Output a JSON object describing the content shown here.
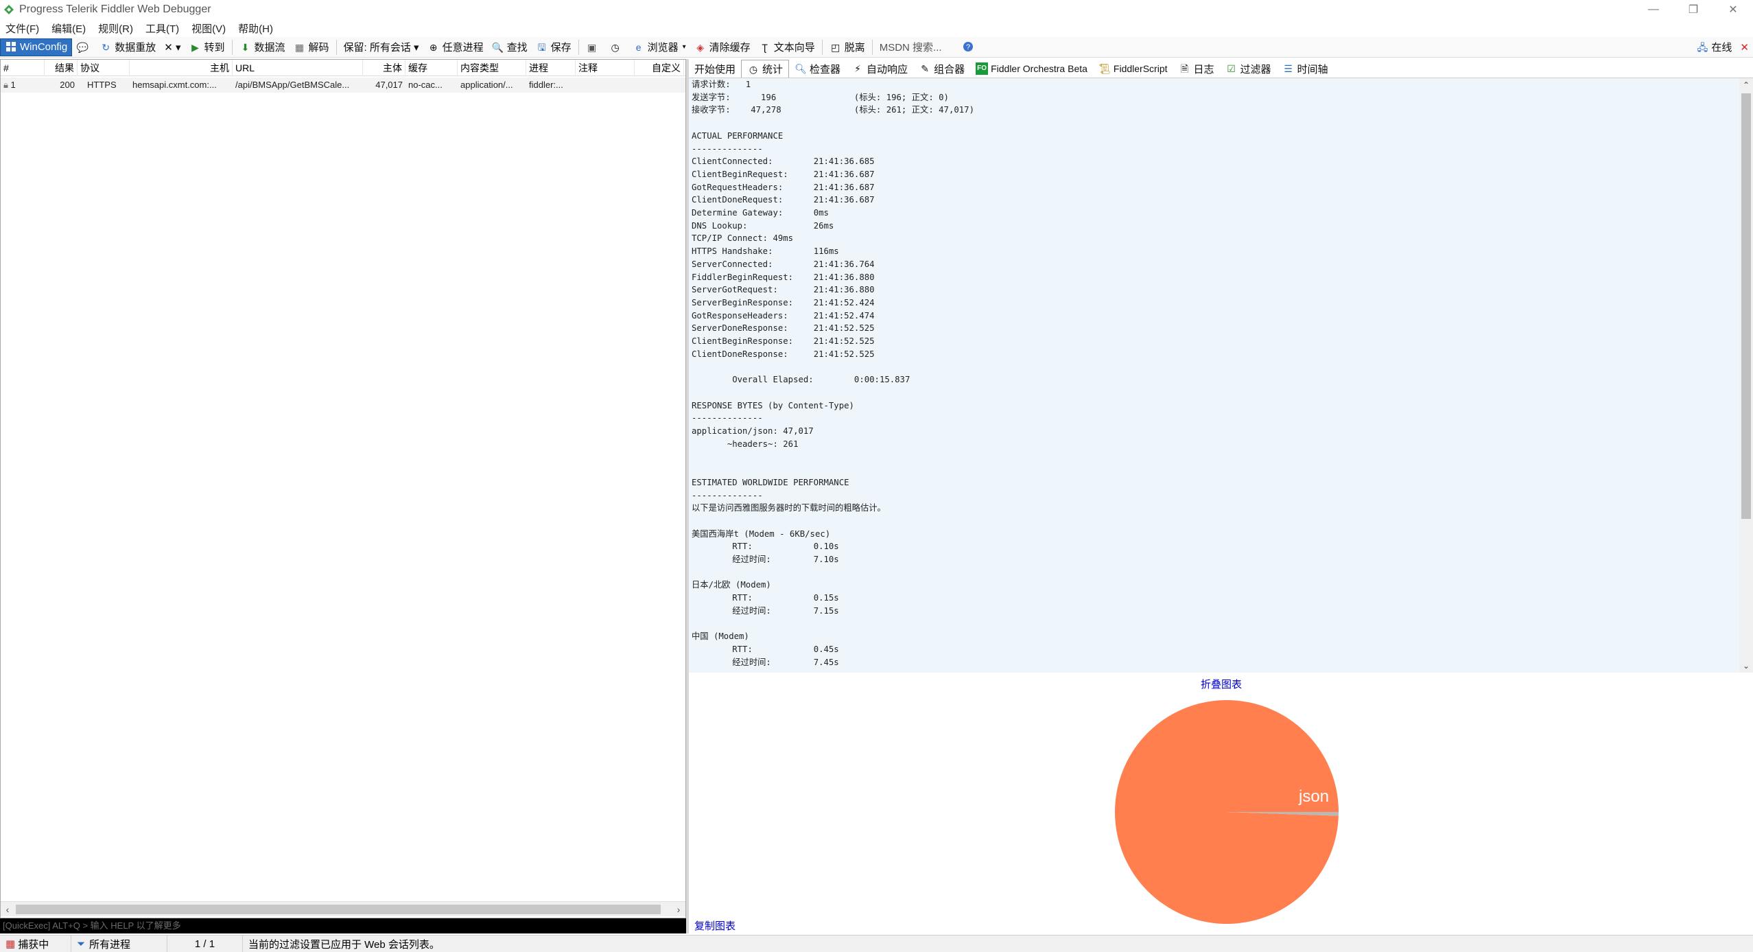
{
  "window": {
    "title": "Progress Telerik Fiddler Web Debugger",
    "controls": [
      "—",
      "❐",
      "✕"
    ]
  },
  "menu": [
    "文件(F)",
    "编辑(E)",
    "规则(R)",
    "工具(T)",
    "视图(V)",
    "帮助(H)"
  ],
  "toolbar": {
    "winconfig": "WinConfig",
    "replay": "数据重放",
    "remove": "✕ ▾",
    "go": "转到",
    "stream": "数据流",
    "decode": "解码",
    "keep": "保留: 所有会话 ▾",
    "any_process": "任意进程",
    "find": "查找",
    "save": "保存",
    "browse": "浏览器",
    "clear_cache": "清除缓存",
    "text_wizard": "文本向导",
    "tearoff": "脱离",
    "msdn_placeholder": "MSDN 搜索...",
    "online": "在线",
    "close": "✕"
  },
  "sessions": {
    "columns": [
      "#",
      "结果",
      "协议",
      "主机",
      "URL",
      "主体",
      "缓存",
      "内容类型",
      "进程",
      "注释",
      "自定义"
    ],
    "rows": [
      {
        "num": "1",
        "result": "200",
        "protocol": "HTTPS",
        "host": "hemsapi.cxmt.com:...",
        "url": "/api/BMSApp/GetBMSCale...",
        "body": "47,017",
        "caching": "no-cac...",
        "content_type": "application/...",
        "process": "fiddler:...",
        "comments": "",
        "custom": ""
      }
    ]
  },
  "quickexec": "[QuickExec] ALT+Q > 输入 HELP 以了解更多",
  "tabs": [
    "开始使用",
    "统计",
    "检查器",
    "自动响应",
    "组合器",
    "Fiddler Orchestra Beta",
    "FiddlerScript",
    "日志",
    "过滤器",
    "时间轴"
  ],
  "stats_text": "请求计数:   1\n发送字节:      196\t\t(标头: 196; 正文: 0)\n接收字节:    47,278\t\t(标头: 261; 正文: 47,017)\n\nACTUAL PERFORMANCE\n--------------\nClientConnected:\t21:41:36.685\nClientBeginRequest:\t21:41:36.687\nGotRequestHeaders:\t21:41:36.687\nClientDoneRequest:\t21:41:36.687\nDetermine Gateway:\t0ms\nDNS Lookup: \t\t26ms\nTCP/IP Connect:\t49ms\nHTTPS Handshake:\t116ms\nServerConnected:\t21:41:36.764\nFiddlerBeginRequest:\t21:41:36.880\nServerGotRequest:\t21:41:36.880\nServerBeginResponse:\t21:41:52.424\nGotResponseHeaders:\t21:41:52.474\nServerDoneResponse:\t21:41:52.525\nClientBeginResponse:\t21:41:52.525\nClientDoneResponse:\t21:41:52.525\n\n\tOverall Elapsed:\t0:00:15.837\n\nRESPONSE BYTES (by Content-Type)\n--------------\napplication/json: 47,017\n       ~headers~: 261\n\n\nESTIMATED WORLDWIDE PERFORMANCE\n--------------\n以下是访问西雅图服务器时的下载时间的粗略估计。\n\n美国西海岸t (Modem - 6KB/sec)\n\tRTT:\t\t0.10s\n\t经过时间:\t7.10s\n\n日本/北欧 (Modem)\n\tRTT:\t\t0.15s\n\t经过时间:\t7.15s\n\n中国 (Modem)\n\tRTT:\t\t0.45s\n\t经过时间:\t7.45s",
  "chart": {
    "collapse_label": "折叠图表",
    "copy_label": "复制图表",
    "pie_color": "#ff7f4f",
    "slices": [
      {
        "label": "json",
        "value": 47017
      },
      {
        "label": "~headers~",
        "value": 261
      }
    ]
  },
  "status": {
    "capturing": "捕获中",
    "process_filter": "所有进程",
    "count": "1 / 1",
    "message": "当前的过滤设置已应用于 Web 会话列表。"
  }
}
